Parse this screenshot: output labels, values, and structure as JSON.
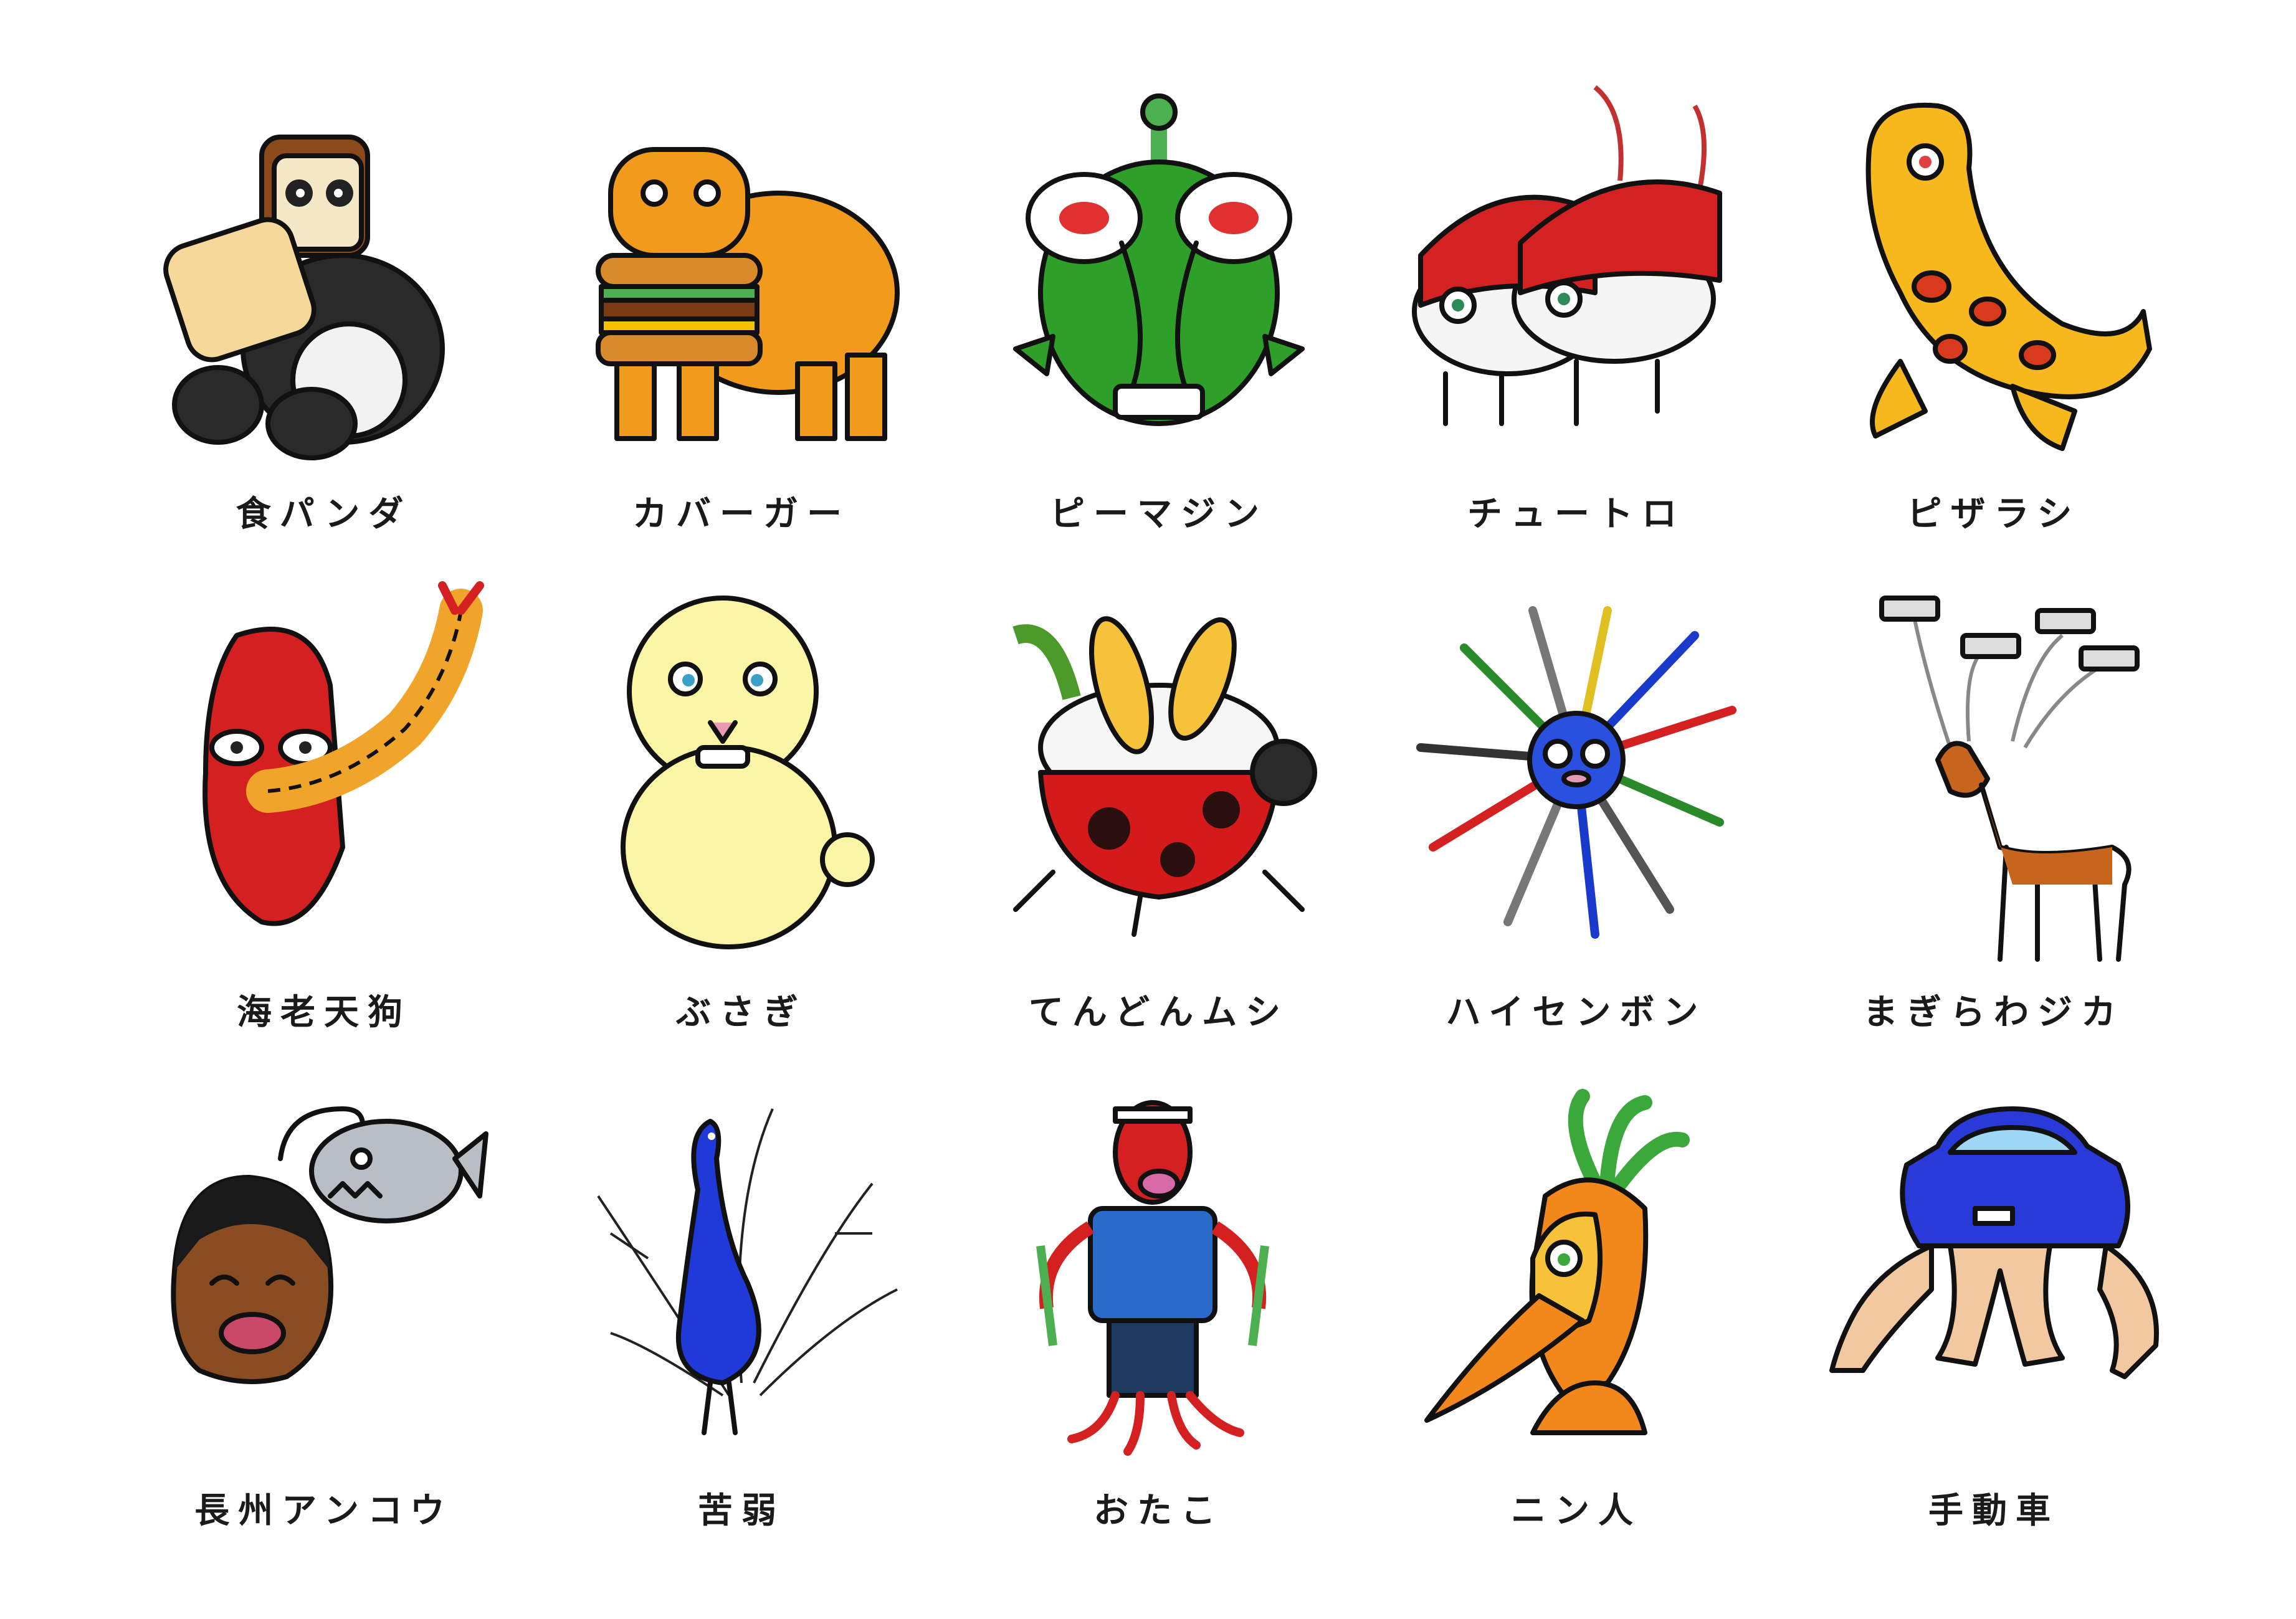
{
  "colors": {
    "ink": "#111111",
    "background": "#ffffff"
  },
  "creatures": [
    {
      "label": "食パンダ",
      "icon": "bread-panda-illustration"
    },
    {
      "label": "カバーガー",
      "icon": "hippo-burger-illustration"
    },
    {
      "label": "ピーマジン",
      "icon": "green-pepper-alien-illustration"
    },
    {
      "label": "チュートロ",
      "icon": "tuna-sushi-mouse-illustration"
    },
    {
      "label": "ピザラシ",
      "icon": "pizza-seal-illustration"
    },
    {
      "label": "海老天狗",
      "icon": "shrimp-tempura-tengu-illustration"
    },
    {
      "label": "ぶさぎ",
      "icon": "ugly-rabbit-illustration"
    },
    {
      "label": "てんどんムシ",
      "icon": "tendon-ladybug-illustration"
    },
    {
      "label": "ハイセンボン",
      "icon": "cable-pufferfish-illustration"
    },
    {
      "label": "まぎらわジカ",
      "icon": "traffic-light-deer-illustration"
    },
    {
      "label": "長州アンコウ",
      "icon": "anglerfish-man-illustration"
    },
    {
      "label": "苦弱",
      "icon": "branch-peacock-illustration"
    },
    {
      "label": "おたこ",
      "icon": "octopus-man-illustration"
    },
    {
      "label": "ニン人",
      "icon": "carrot-person-illustration"
    },
    {
      "label": "手動車",
      "icon": "car-man-illustration"
    }
  ]
}
